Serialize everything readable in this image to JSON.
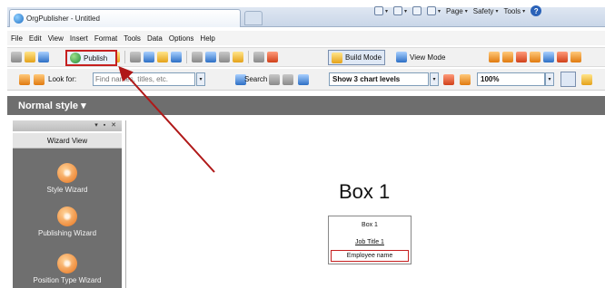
{
  "browser": {
    "tab_title": "OrgPublisher - Untitled",
    "commands": [
      {
        "label": "",
        "icon": "home-icon"
      },
      {
        "label": "",
        "icon": "feeds-icon"
      },
      {
        "label": "",
        "icon": "mail-icon"
      },
      {
        "label": "",
        "icon": "print-icon"
      },
      {
        "label": "Page",
        "icon": "page-icon"
      },
      {
        "label": "Safety",
        "icon": "safety-icon"
      },
      {
        "label": "Tools",
        "icon": "tools-icon"
      }
    ]
  },
  "menu": [
    "File",
    "Edit",
    "View",
    "Insert",
    "Format",
    "Tools",
    "Data",
    "Options",
    "Help"
  ],
  "toolbar": {
    "publish_label": "Publish",
    "build_mode_label": "Build Mode",
    "view_mode_label": "View Mode"
  },
  "search": {
    "look_for_label": "Look for:",
    "placeholder": "Find names, titles, etc.",
    "search_label": "Search",
    "levels_value": "Show 3 chart levels",
    "zoom_value": "100%"
  },
  "style": {
    "label": "Normal style"
  },
  "wizard_panel": {
    "title": "Wizard View",
    "controls": "▾ ▪ ✕",
    "items": [
      {
        "label": "Style Wizard",
        "icon": "style-wizard-icon"
      },
      {
        "label": "Publishing Wizard",
        "icon": "publishing-wizard-icon"
      },
      {
        "label": "Position Type Wizard",
        "icon": "position-type-wizard-icon"
      }
    ]
  },
  "chart": {
    "title": "Box 1",
    "box_name": "Box 1",
    "job_title": "Job Title 1",
    "employee": "Employee name"
  },
  "colors": {
    "highlight": "#c62020",
    "style_bar": "#6e6e6e",
    "wizard_icon": "#e8721a"
  }
}
